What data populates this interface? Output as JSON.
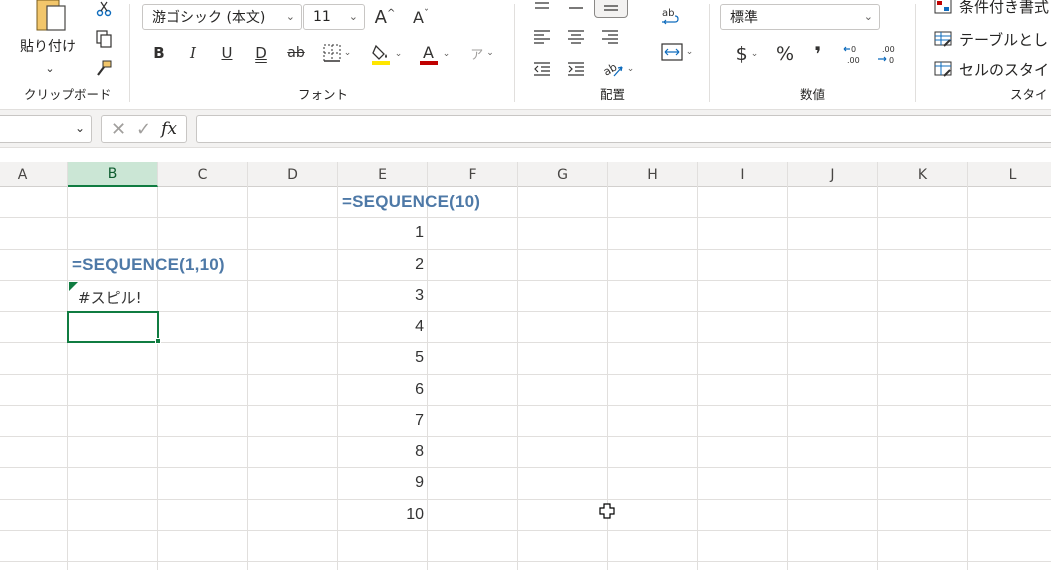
{
  "ribbon": {
    "clipboard": {
      "paste_label": "貼り付け",
      "group_label": "クリップボード"
    },
    "font": {
      "font_name": "游ゴシック (本文)",
      "font_size": "11",
      "bold": "B",
      "italic": "I",
      "underline": "U",
      "double_underline": "D",
      "strike": "ab",
      "font_color_glyph": "A",
      "phonetic_glyph": "ア",
      "group_label": "フォント"
    },
    "alignment": {
      "group_label": "配置"
    },
    "number": {
      "format": "標準",
      "currency": "$",
      "percent": "%",
      "comma": "❜",
      "group_label": "数値"
    },
    "styles": {
      "conditional": "条件付き書式",
      "table": "テーブルとし",
      "cell_styles": "セルのスタイ",
      "group_label": "スタイ"
    }
  },
  "formula_bar": {
    "name_box": "",
    "content": ""
  },
  "grid": {
    "columns": [
      "A",
      "B",
      "C",
      "D",
      "E",
      "F",
      "G",
      "H",
      "I",
      "J",
      "K",
      "L"
    ],
    "selected_column": "B",
    "cells": {
      "E1": "=SEQUENCE(10)",
      "E2": "1",
      "E3": "2",
      "E4": "3",
      "E5": "4",
      "E6": "5",
      "E7": "6",
      "E8": "7",
      "E9": "8",
      "E10": "9",
      "E11": "10",
      "B3": "=SEQUENCE(1,10)",
      "B4": "#スピル!"
    },
    "active_cell": "B5"
  },
  "colors": {
    "accent": "#107c41",
    "formula_text": "#4e79a7"
  }
}
